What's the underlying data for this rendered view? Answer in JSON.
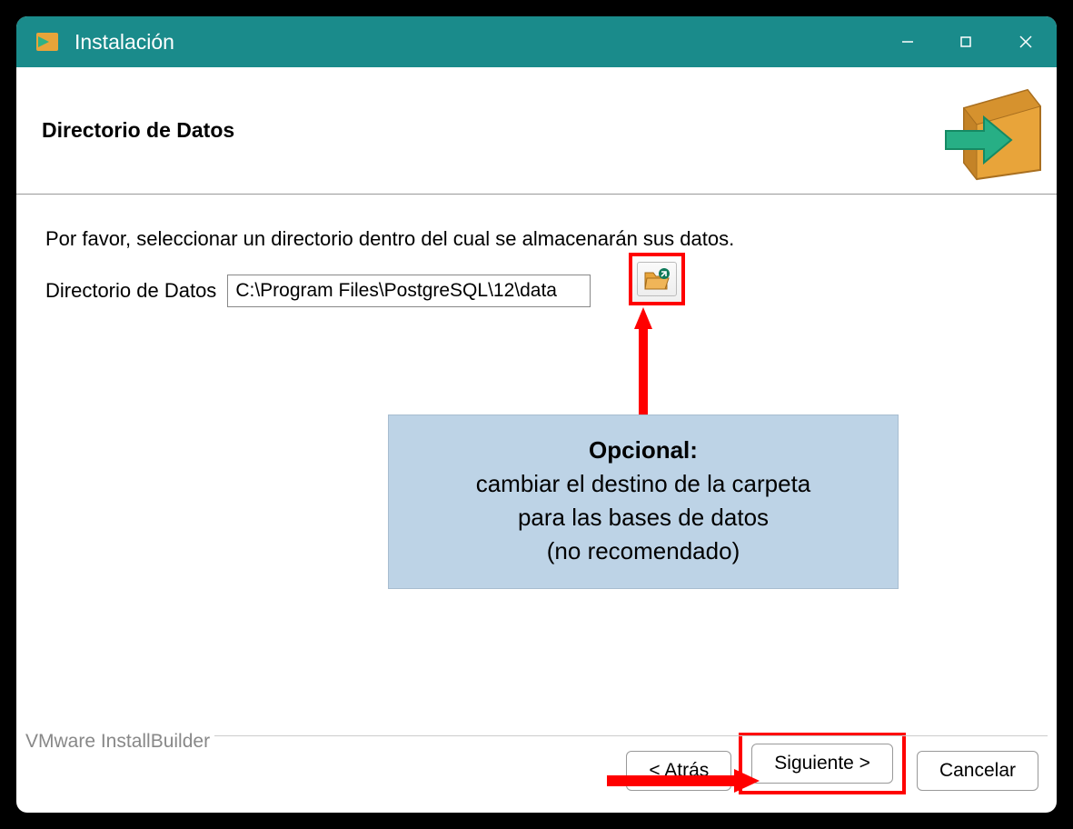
{
  "window": {
    "title": "Instalación"
  },
  "header": {
    "title": "Directorio de Datos"
  },
  "content": {
    "instruction": "Por favor, seleccionar un directorio dentro del cual se almacenarán sus datos.",
    "field_label": "Directorio de Datos",
    "path_value": "C:\\Program Files\\PostgreSQL\\12\\data"
  },
  "callout": {
    "title": "Opcional:",
    "line1": "cambiar el destino de la carpeta",
    "line2": "para las bases de datos",
    "line3": "(no recomendado)"
  },
  "footer": {
    "builder": "VMware InstallBuilder",
    "back": "< Atrás",
    "next": "Siguiente >",
    "cancel": "Cancelar"
  }
}
